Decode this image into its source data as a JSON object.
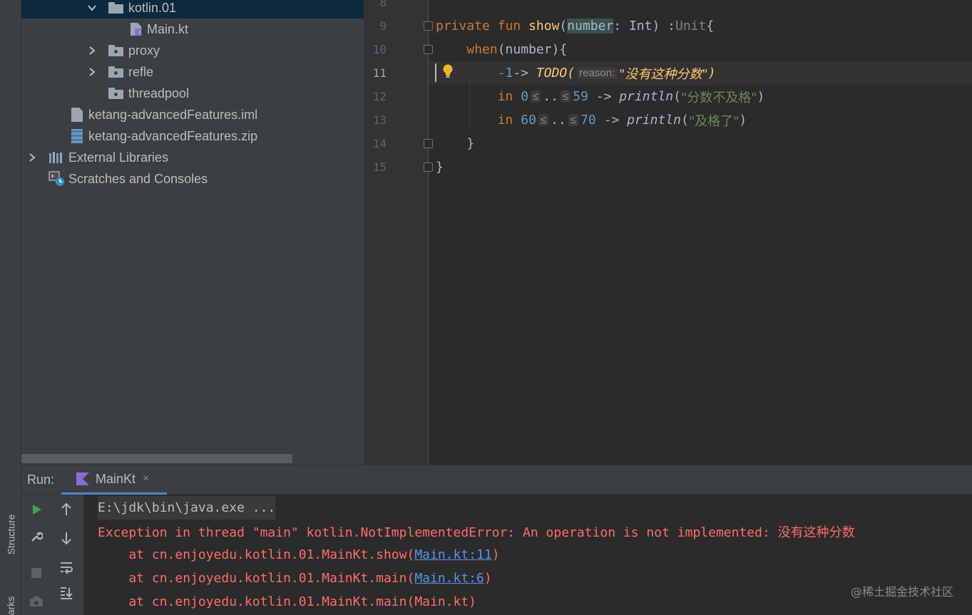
{
  "side_tabs": {
    "structure": "Structure",
    "bookmarks": "arks"
  },
  "project_tree": [
    {
      "label": "kotlin.01",
      "type": "folder",
      "expanded": true,
      "selected": true
    },
    {
      "label": "Main.kt",
      "type": "kotlin-file"
    },
    {
      "label": "proxy",
      "type": "folder",
      "expanded": false
    },
    {
      "label": "refle",
      "type": "folder",
      "expanded": false
    },
    {
      "label": "threadpool",
      "type": "folder"
    },
    {
      "label": "ketang-advancedFeatures.iml",
      "type": "iml-file"
    },
    {
      "label": "ketang-advancedFeatures.zip",
      "type": "zip-file"
    },
    {
      "label": "External Libraries",
      "type": "libraries",
      "expanded": false
    },
    {
      "label": "Scratches and Consoles",
      "type": "scratches"
    }
  ],
  "editor": {
    "line_numbers": [
      "8",
      "9",
      "10",
      "11",
      "12",
      "13",
      "14",
      "15"
    ],
    "current_line": "11",
    "code": {
      "l9_private": "private",
      "l9_fun": "fun",
      "l9_name": "show",
      "l9_open": "(",
      "l9_param": "number",
      "l9_rest": ": Int) :",
      "l9_unit": "Unit",
      "l9_brace": "{",
      "l10_when": "when",
      "l10_rest": "(number){",
      "l11_num": "-1",
      "l11_arrow": "-> ",
      "l11_todo": "TODO(",
      "l11_hint": "reason:",
      "l11_str": "\"没有这种分数\"",
      "l11_close": ")",
      "l12_in": "in",
      "l12_start": "0",
      "l12_le1": "≤",
      "l12_dots": "..",
      "l12_le2": "≤",
      "l12_end": "59",
      "l12_arrow": " -> ",
      "l12_fn": "println",
      "l12_open": "(",
      "l12_str": "\"分数不及格\"",
      "l12_close": ")",
      "l13_in": "in",
      "l13_start": "60",
      "l13_le1": "≤",
      "l13_dots": "..",
      "l13_le2": "≤",
      "l13_end": "70",
      "l13_arrow": " -> ",
      "l13_fn": "println",
      "l13_open": "(",
      "l13_str": "\"及格了\"",
      "l13_close": ")",
      "l14": "}",
      "l15": "}"
    }
  },
  "run_panel": {
    "label": "Run:",
    "tab_name": "MainKt",
    "tab_close": "×"
  },
  "console": {
    "command": "E:\\jdk\\bin\\java.exe ...",
    "error": "Exception in thread \"main\" kotlin.NotImplementedError: An operation is not implemented: 没有这种分数",
    "trace": [
      {
        "prefix": "    at cn.enjoyedu.kotlin.01.MainKt.show(",
        "link": "Main.kt:11",
        "suffix": ")"
      },
      {
        "prefix": "    at cn.enjoyedu.kotlin.01.MainKt.main(",
        "link": "Main.kt:6",
        "suffix": ")"
      },
      {
        "prefix": "    at cn.enjoyedu.kotlin.01.MainKt.main(Main.kt)",
        "link": "",
        "suffix": ""
      }
    ]
  },
  "watermark": "@稀土掘金技术社区",
  "colors": {
    "keyword": "#cc7832",
    "function": "#ffc66d",
    "number": "#6897bb",
    "string": "#6a8759",
    "error": "#ff6b68",
    "link": "#5394ec",
    "run_green": "#499c54"
  }
}
